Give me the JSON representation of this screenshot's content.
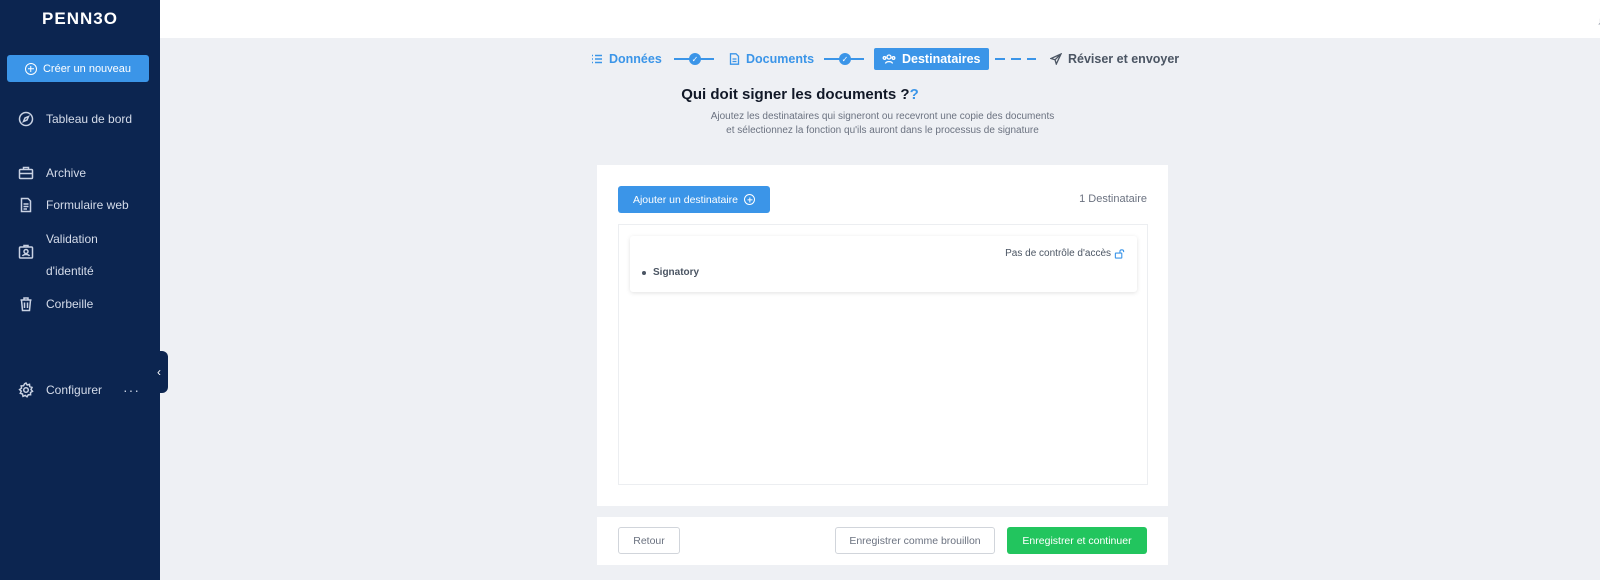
{
  "app": {
    "logo": "PENN3O"
  },
  "sidebar": {
    "create_label": "Créer un nouveau",
    "items": [
      {
        "label": "Tableau de bord",
        "icon": "compass-icon"
      },
      {
        "label": "Archive",
        "icon": "briefcase-icon"
      },
      {
        "label": "Formulaire web",
        "icon": "file-icon"
      },
      {
        "label": "Validation",
        "label2": "d'identité",
        "icon": "id-card-icon"
      },
      {
        "label": "Corbeille",
        "icon": "trash-icon"
      },
      {
        "label": "Configurer",
        "icon": "gear-icon",
        "more": "···"
      }
    ]
  },
  "stepper": {
    "steps": [
      {
        "label": "Données",
        "state": "done",
        "icon": "list-icon"
      },
      {
        "label": "Documents",
        "state": "done",
        "icon": "file-icon"
      },
      {
        "label": "Destinataires",
        "state": "active",
        "icon": "users-icon"
      },
      {
        "label": "Réviser et envoyer",
        "state": "pending",
        "icon": "send-icon"
      }
    ]
  },
  "header": {
    "title": "Qui doit signer les documents ?",
    "title_mark": "?",
    "subtitle": "Ajoutez les destinataires qui signeront ou recevront une copie des documents et sélectionnez la fonction qu'ils auront dans le processus de signature"
  },
  "recipients": {
    "add_label": "Ajouter un destinataire",
    "count_label": "1 Destinataire",
    "list": [
      {
        "access_label": "Pas de contrôle d'accès",
        "role": "Signatory"
      }
    ]
  },
  "footer": {
    "back_label": "Retour",
    "draft_label": "Enregistrer comme brouillon",
    "continue_label": "Enregistrer et continuer"
  },
  "colors": {
    "sidebar_bg": "#0c2550",
    "accent": "#3b95e8",
    "success": "#22c55e",
    "page_bg": "#eef0f4"
  }
}
